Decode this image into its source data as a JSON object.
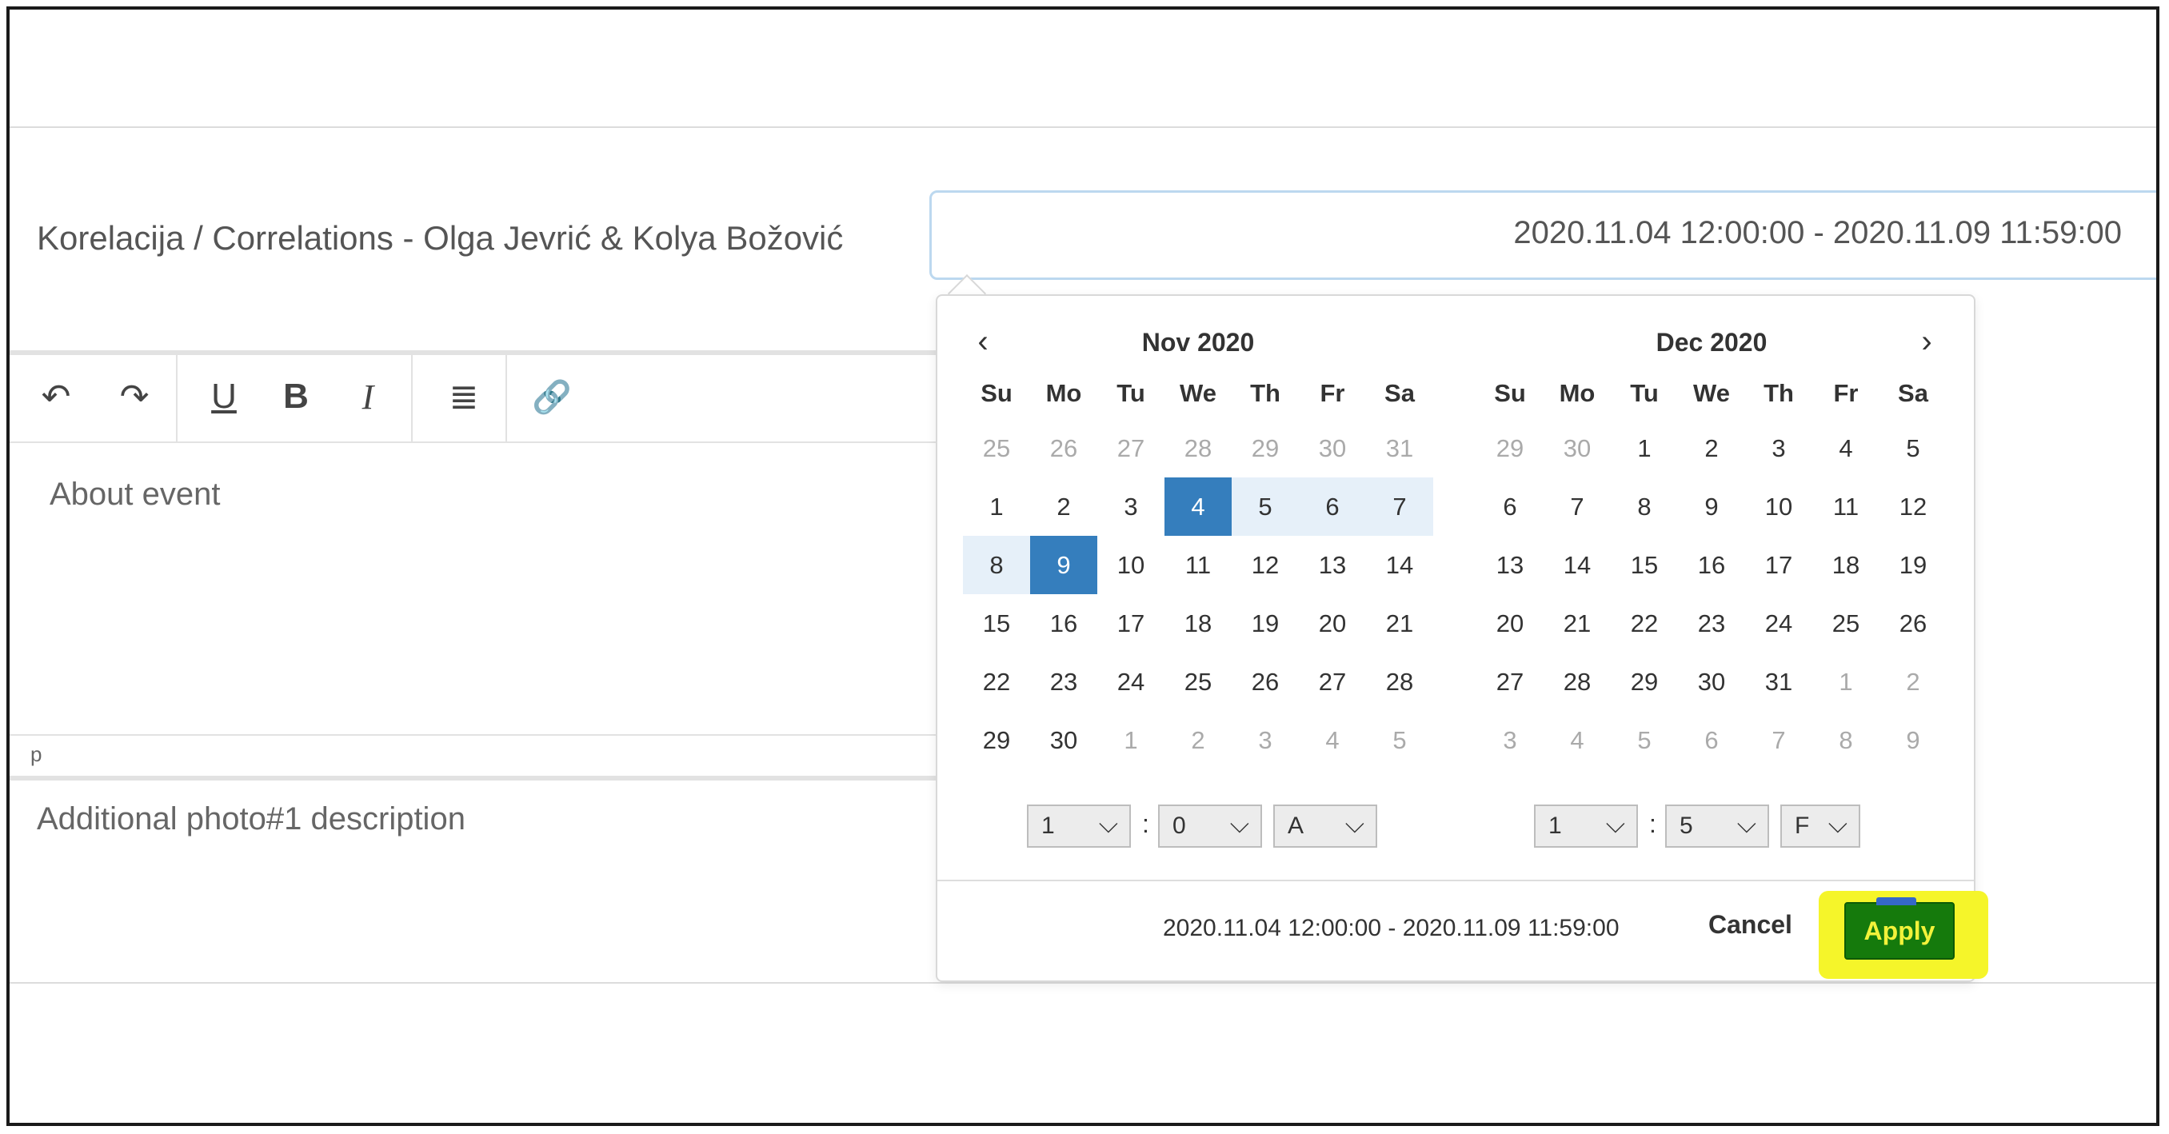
{
  "event": {
    "title": "Korelacija / Correlations - Olga Jevrić & Kolya Božović",
    "date_range_value": "2020.11.04 12:00:00 - 2020.11.09 11:59:00"
  },
  "editor": {
    "toolbar": [
      {
        "name": "undo-icon",
        "glyph": "↶"
      },
      {
        "name": "redo-icon",
        "glyph": "↷"
      },
      {
        "name": "underline-icon",
        "glyph": "U"
      },
      {
        "name": "bold-icon",
        "glyph": "B"
      },
      {
        "name": "italic-icon",
        "glyph": "I"
      },
      {
        "name": "align-justify-icon",
        "glyph": "≣"
      },
      {
        "name": "link-icon",
        "glyph": "🔗"
      }
    ],
    "placeholder": "About event",
    "status_path": "p"
  },
  "additional_photo_placeholder": "Additional photo#1 description",
  "datepicker": {
    "weekdays": [
      "Su",
      "Mo",
      "Tu",
      "We",
      "Th",
      "Fr",
      "Sa"
    ],
    "left": {
      "month": "Nov 2020",
      "weeks": [
        [
          [
            "25",
            "off"
          ],
          [
            "26",
            "off"
          ],
          [
            "27",
            "off"
          ],
          [
            "28",
            "off"
          ],
          [
            "29",
            "off"
          ],
          [
            "30",
            "off"
          ],
          [
            "31",
            "off"
          ]
        ],
        [
          [
            "1",
            ""
          ],
          [
            "2",
            ""
          ],
          [
            "3",
            ""
          ],
          [
            "4",
            "sel"
          ],
          [
            "5",
            "inrange"
          ],
          [
            "6",
            "inrange"
          ],
          [
            "7",
            "inrange"
          ]
        ],
        [
          [
            "8",
            "inrange"
          ],
          [
            "9",
            "sel"
          ],
          [
            "10",
            ""
          ],
          [
            "11",
            ""
          ],
          [
            "12",
            ""
          ],
          [
            "13",
            ""
          ],
          [
            "14",
            ""
          ]
        ],
        [
          [
            "15",
            ""
          ],
          [
            "16",
            ""
          ],
          [
            "17",
            ""
          ],
          [
            "18",
            ""
          ],
          [
            "19",
            ""
          ],
          [
            "20",
            ""
          ],
          [
            "21",
            ""
          ]
        ],
        [
          [
            "22",
            ""
          ],
          [
            "23",
            ""
          ],
          [
            "24",
            ""
          ],
          [
            "25",
            ""
          ],
          [
            "26",
            ""
          ],
          [
            "27",
            ""
          ],
          [
            "28",
            ""
          ]
        ],
        [
          [
            "29",
            ""
          ],
          [
            "30",
            ""
          ],
          [
            "1",
            "off"
          ],
          [
            "2",
            "off"
          ],
          [
            "3",
            "off"
          ],
          [
            "4",
            "off"
          ],
          [
            "5",
            "off"
          ]
        ]
      ],
      "time": {
        "hour": "1",
        "minute": "0",
        "ampm": "A"
      }
    },
    "right": {
      "month": "Dec 2020",
      "weeks": [
        [
          [
            "29",
            "off"
          ],
          [
            "30",
            "off"
          ],
          [
            "1",
            ""
          ],
          [
            "2",
            ""
          ],
          [
            "3",
            ""
          ],
          [
            "4",
            ""
          ],
          [
            "5",
            ""
          ]
        ],
        [
          [
            "6",
            ""
          ],
          [
            "7",
            ""
          ],
          [
            "8",
            ""
          ],
          [
            "9",
            ""
          ],
          [
            "10",
            ""
          ],
          [
            "11",
            ""
          ],
          [
            "12",
            ""
          ]
        ],
        [
          [
            "13",
            ""
          ],
          [
            "14",
            ""
          ],
          [
            "15",
            ""
          ],
          [
            "16",
            ""
          ],
          [
            "17",
            ""
          ],
          [
            "18",
            ""
          ],
          [
            "19",
            ""
          ]
        ],
        [
          [
            "20",
            ""
          ],
          [
            "21",
            ""
          ],
          [
            "22",
            ""
          ],
          [
            "23",
            ""
          ],
          [
            "24",
            ""
          ],
          [
            "25",
            ""
          ],
          [
            "26",
            ""
          ]
        ],
        [
          [
            "27",
            ""
          ],
          [
            "28",
            ""
          ],
          [
            "29",
            ""
          ],
          [
            "30",
            ""
          ],
          [
            "31",
            ""
          ],
          [
            "1",
            "off"
          ],
          [
            "2",
            "off"
          ]
        ],
        [
          [
            "3",
            "off"
          ],
          [
            "4",
            "off"
          ],
          [
            "5",
            "off"
          ],
          [
            "6",
            "off"
          ],
          [
            "7",
            "off"
          ],
          [
            "8",
            "off"
          ],
          [
            "9",
            "off"
          ]
        ]
      ],
      "time": {
        "hour": "1",
        "minute": "5",
        "ampm": "F"
      }
    },
    "prev_glyph": "‹",
    "next_glyph": "›",
    "time_colon": ":",
    "chevron_glyph": "⌵",
    "selected_range_text": "2020.11.04 12:00:00 - 2020.11.09 11:59:00",
    "cancel_label": "Cancel",
    "apply_label": "Apply",
    "colors": {
      "selected": "#357ebd",
      "in_range": "#e6f0f9",
      "apply_bg": "#157a0c",
      "apply_text": "#f2f23a",
      "highlight": "#f5f52a"
    }
  }
}
